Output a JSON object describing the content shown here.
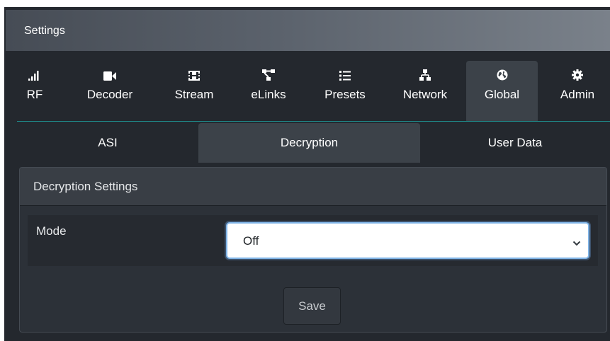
{
  "title_bar": {
    "title": "Settings"
  },
  "main_nav": {
    "items": [
      {
        "label": "RF",
        "icon": "signal-bars-icon"
      },
      {
        "label": "Decoder",
        "icon": "video-camera-icon"
      },
      {
        "label": "Stream",
        "icon": "film-icon"
      },
      {
        "label": "eLinks",
        "icon": "project-diagram-icon"
      },
      {
        "label": "Presets",
        "icon": "list-icon"
      },
      {
        "label": "Network",
        "icon": "sitemap-icon"
      },
      {
        "label": "Global",
        "icon": "globe-icon"
      },
      {
        "label": "Admin",
        "icon": "gear-icon"
      }
    ],
    "active": "Global"
  },
  "sub_tabs": {
    "items": [
      {
        "label": "ASI"
      },
      {
        "label": "Decryption"
      },
      {
        "label": "User Data"
      }
    ],
    "active": "Decryption"
  },
  "panel": {
    "header": "Decryption Settings",
    "mode_label": "Mode",
    "mode_value": "Off",
    "save_label": "Save"
  },
  "colors": {
    "background": "#24282e",
    "active_tab": "#3c4249",
    "accent_line": "#1e8c8c",
    "select_focus": "#7fb3e6"
  }
}
